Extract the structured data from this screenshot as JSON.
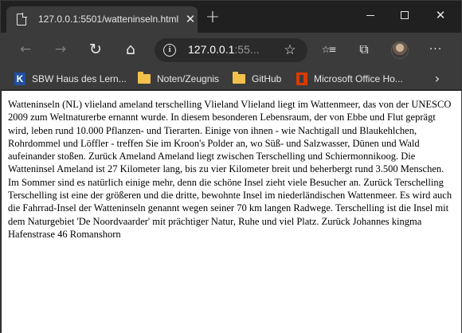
{
  "tab": {
    "title": "127.0.0.1:5501/watteninseln.html",
    "close": "✕"
  },
  "titlebar": {
    "new_tab": "+",
    "close": "✕"
  },
  "toolbar": {
    "back": "←",
    "forward": "→",
    "reload": "↻",
    "home": "⌂",
    "url_host": "127.0.0.1",
    "url_rest": ":55...",
    "favorite": "☆",
    "favorites": "☆≡",
    "collections": "⧉",
    "menu": "···"
  },
  "bookmarks": {
    "items": [
      {
        "label": "SBW Haus des Lern...",
        "icon": "k-icon"
      },
      {
        "label": "Noten/Zeugnis",
        "icon": "folder-icon"
      },
      {
        "label": "GitHub",
        "icon": "folder-icon"
      },
      {
        "label": "Microsoft Office Ho...",
        "icon": "office-icon"
      }
    ],
    "more": "›"
  },
  "content": {
    "text": "Watteninseln (NL) vlieland ameland terschelling Vlieland Vlieland liegt im Wattenmeer, das von der UNESCO 2009 zum Weltnaturerbe ernannt wurde. In diesem besonderen Lebensraum, der von Ebbe und Flut geprägt wird, leben rund 10.000 Pflanzen- und Tierarten. Einige von ihnen - wie Nachtigall und Blaukehlchen, Rohrdommel und Löffler - treffen Sie im Kroon's Polder an, wo Süß- und Salzwasser, Dünen und Wald aufeinander stoßen. Zurück Ameland Ameland liegt zwischen Terschelling und Schiermonnikoog. Die Watteninsel Ameland ist 27 Kilometer lang, bis zu vier Kilometer breit und beherbergt rund 3.500 Menschen. Im Sommer sind es natürlich einige mehr, denn die schöne Insel zieht viele Besucher an. Zurück Terschelling Terschelling ist eine der größeren und die dritte, bewohnte Insel im niederländischen Wattenmeer. Es wird auch die Fahrrad-Insel der Watteninseln genannt wegen seiner 70 km langen Radwege. Terschelling ist die Insel mit dem Naturgebiet 'De Noordvaarder' mit prächtiger Natur, Ruhe und viel Platz. Zurück Johannes kingma Hafenstrase 46 Romanshorn"
  }
}
